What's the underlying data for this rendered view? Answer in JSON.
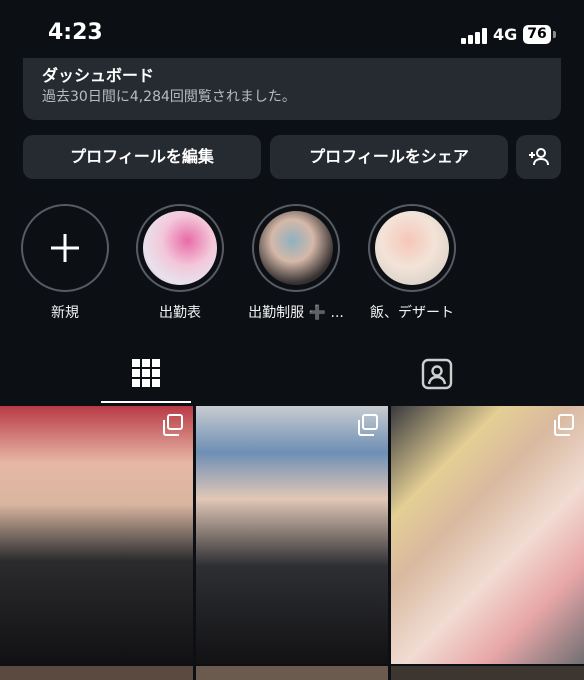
{
  "status": {
    "time": "4:23",
    "network": "4G",
    "battery": "76"
  },
  "dashboard": {
    "title": "ダッシュボード",
    "subtitle": "過去30日間に4,284回閲覧されました。"
  },
  "buttons": {
    "edit_profile": "プロフィールを編集",
    "share_profile": "プロフィールをシェア"
  },
  "highlights": [
    {
      "label": "新規",
      "icon": "plus-icon"
    },
    {
      "label": "出勤表"
    },
    {
      "label": "出勤制服 ➕ ..."
    },
    {
      "label": "飯、デザート"
    }
  ],
  "tabs": [
    {
      "icon": "grid-icon",
      "active": true
    },
    {
      "icon": "tagged-person-icon",
      "active": false
    }
  ],
  "colors": {
    "background": "#0c0f14",
    "card": "#262a31",
    "text": "#f5f5f5"
  }
}
